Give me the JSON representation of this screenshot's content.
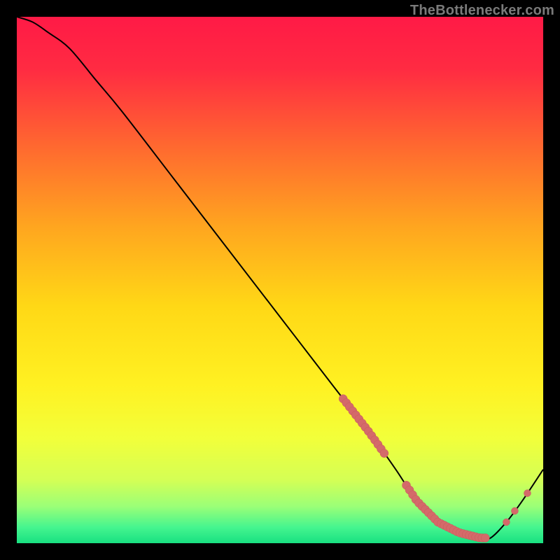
{
  "attribution": "TheBottlenecker.com",
  "chart_data": {
    "type": "line",
    "title": "",
    "xlabel": "",
    "ylabel": "",
    "xlim": [
      0,
      100
    ],
    "ylim": [
      0,
      100
    ],
    "series": [
      {
        "name": "curve",
        "x": [
          0,
          3,
          6,
          10,
          15,
          20,
          30,
          40,
          50,
          60,
          67,
          72,
          76,
          80,
          84,
          88,
          90,
          93,
          96,
          100
        ],
        "y": [
          100,
          99,
          97,
          94,
          88,
          82,
          69,
          56,
          43,
          30,
          21,
          14,
          8,
          4,
          2,
          1,
          1,
          4,
          8,
          14
        ]
      }
    ],
    "highlight_ranges": [
      {
        "start_x": 62,
        "end_x": 70,
        "density": "dense"
      },
      {
        "start_x": 74,
        "end_x": 89,
        "density": "dense"
      },
      {
        "start_x": 93,
        "end_x": 95,
        "density": "sparse"
      },
      {
        "start_x": 97,
        "end_x": 98,
        "density": "sparse"
      }
    ],
    "gradient_stops": [
      {
        "offset": 0.0,
        "color": "#ff1a46"
      },
      {
        "offset": 0.1,
        "color": "#ff2b42"
      },
      {
        "offset": 0.25,
        "color": "#ff6a2f"
      },
      {
        "offset": 0.4,
        "color": "#ffa61f"
      },
      {
        "offset": 0.55,
        "color": "#ffd816"
      },
      {
        "offset": 0.7,
        "color": "#fff122"
      },
      {
        "offset": 0.8,
        "color": "#f2ff3a"
      },
      {
        "offset": 0.88,
        "color": "#d4ff55"
      },
      {
        "offset": 0.93,
        "color": "#9bff77"
      },
      {
        "offset": 0.97,
        "color": "#45f58f"
      },
      {
        "offset": 1.0,
        "color": "#18e081"
      }
    ],
    "colors": {
      "curve_stroke": "#000000",
      "highlight_fill": "#d46a6a",
      "highlight_stroke": "#c85a5a"
    }
  }
}
